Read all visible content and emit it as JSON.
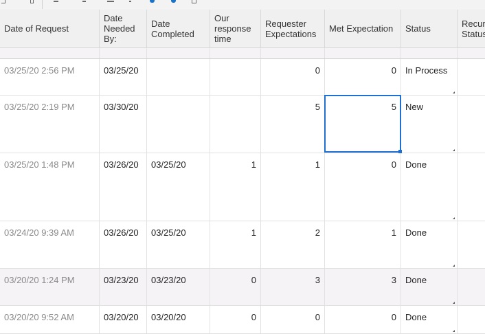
{
  "columns": [
    {
      "label": "Date of Request"
    },
    {
      "label": "Date\nNeeded\nBy:"
    },
    {
      "label": "Date\nCompleted"
    },
    {
      "label": "Our\nresponse\ntime"
    },
    {
      "label": "Requester\nExpectations"
    },
    {
      "label": "Met Expectation"
    },
    {
      "label": "Status"
    },
    {
      "label": "Recur\nStatus"
    }
  ],
  "rows": [
    {
      "date_request": "03/25/20 2:56 PM",
      "date_needed": "03/25/20",
      "date_completed": "",
      "response_time": "",
      "requester_expectations": "0",
      "met_expectation": "0",
      "status": "In Process"
    },
    {
      "date_request": "03/25/20 2:19 PM",
      "date_needed": "03/30/20",
      "date_completed": "",
      "response_time": "",
      "requester_expectations": "5",
      "met_expectation": "5",
      "status": "New"
    },
    {
      "date_request": "03/25/20 1:48 PM",
      "date_needed": "03/26/20",
      "date_completed": "03/25/20",
      "response_time": "1",
      "requester_expectations": "1",
      "met_expectation": "0",
      "status": "Done"
    },
    {
      "date_request": "03/24/20 9:39 AM",
      "date_needed": "03/26/20",
      "date_completed": "03/25/20",
      "response_time": "1",
      "requester_expectations": "2",
      "met_expectation": "1",
      "status": "Done"
    },
    {
      "date_request": "03/20/20 1:24 PM",
      "date_needed": "03/23/20",
      "date_completed": "03/23/20",
      "response_time": "0",
      "requester_expectations": "3",
      "met_expectation": "3",
      "status": "Done"
    },
    {
      "date_request": "03/20/20 9:52 AM",
      "date_needed": "03/20/20",
      "date_completed": "03/20/20",
      "response_time": "0",
      "requester_expectations": "0",
      "met_expectation": "0",
      "status": "Done"
    }
  ],
  "colors": {
    "selection": "#1f6fd1",
    "header_bg": "#f0f0f0",
    "alt_row_bg": "#f6f3f7",
    "toolbar_accent": "#1a73c8"
  },
  "toolbar": {
    "icons": [
      "minus-icon",
      "plus-icon",
      "percent-icon",
      "undo-icon",
      "redo-icon",
      "box-icon"
    ]
  }
}
